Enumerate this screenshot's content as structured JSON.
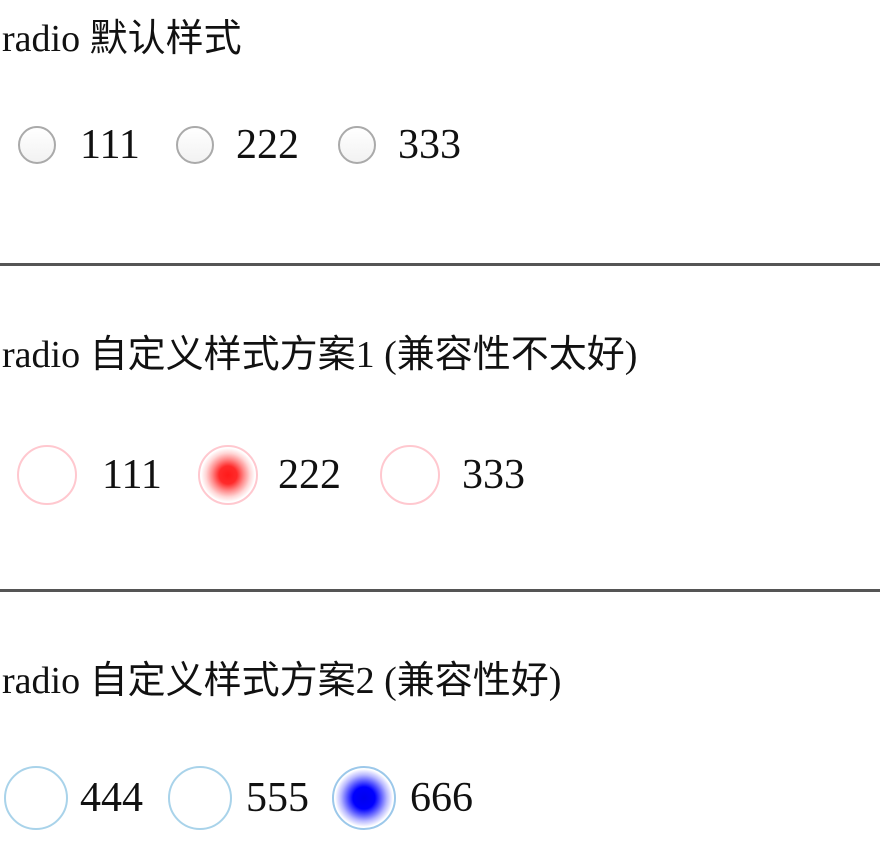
{
  "section1": {
    "heading": "radio 默认样式",
    "options": [
      {
        "label": "111",
        "checked": false
      },
      {
        "label": "222",
        "checked": false
      },
      {
        "label": "333",
        "checked": false
      }
    ]
  },
  "section2": {
    "heading": "radio 自定义样式方案1 (兼容性不太好)",
    "accent": "#ff0000",
    "border": "#ffc8cf",
    "options": [
      {
        "label": "111",
        "checked": false
      },
      {
        "label": "222",
        "checked": true
      },
      {
        "label": "333",
        "checked": false
      }
    ]
  },
  "section3": {
    "heading": "radio 自定义样式方案2 (兼容性好)",
    "accent": "#0000ff",
    "border": "#a9d3ea",
    "options": [
      {
        "label": "444",
        "checked": false
      },
      {
        "label": "555",
        "checked": false
      },
      {
        "label": "666",
        "checked": true
      }
    ]
  },
  "divider_color": "#555555"
}
